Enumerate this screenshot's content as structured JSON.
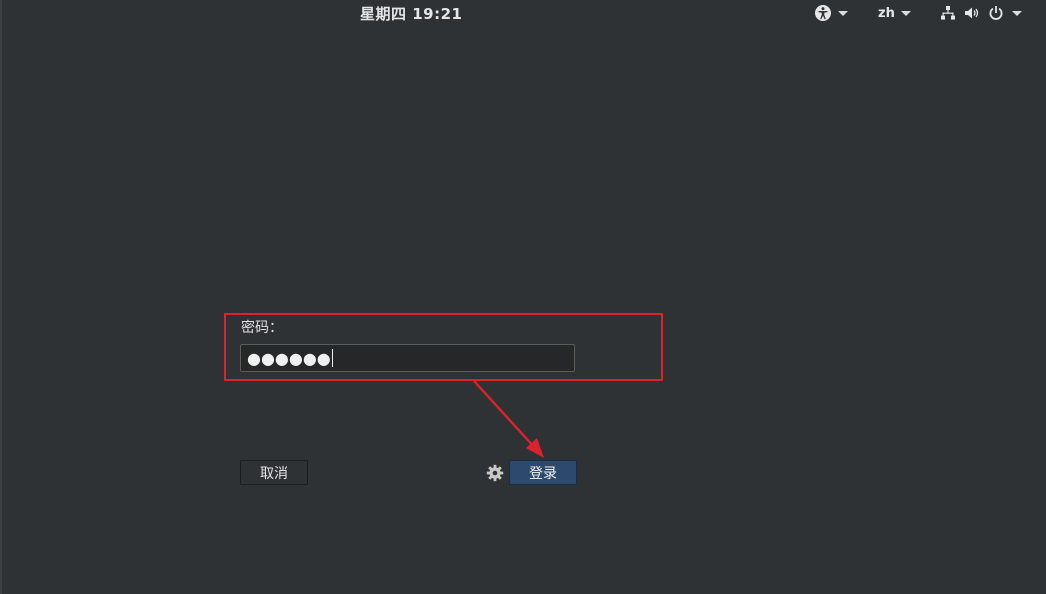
{
  "topbar": {
    "clock": "星期四 19:21",
    "language": "zh",
    "icons": [
      "accessibility-icon",
      "network-icon",
      "volume-icon",
      "power-icon"
    ]
  },
  "login": {
    "prompt_label": "密码：",
    "password_value": "●●●●●●",
    "cancel_label": "取消",
    "login_label": "登录",
    "settings_icon": "gear-icon"
  },
  "colors": {
    "background": "#2e3235",
    "accent_button": "#2c4a6e",
    "annotation": "#d9232d"
  }
}
